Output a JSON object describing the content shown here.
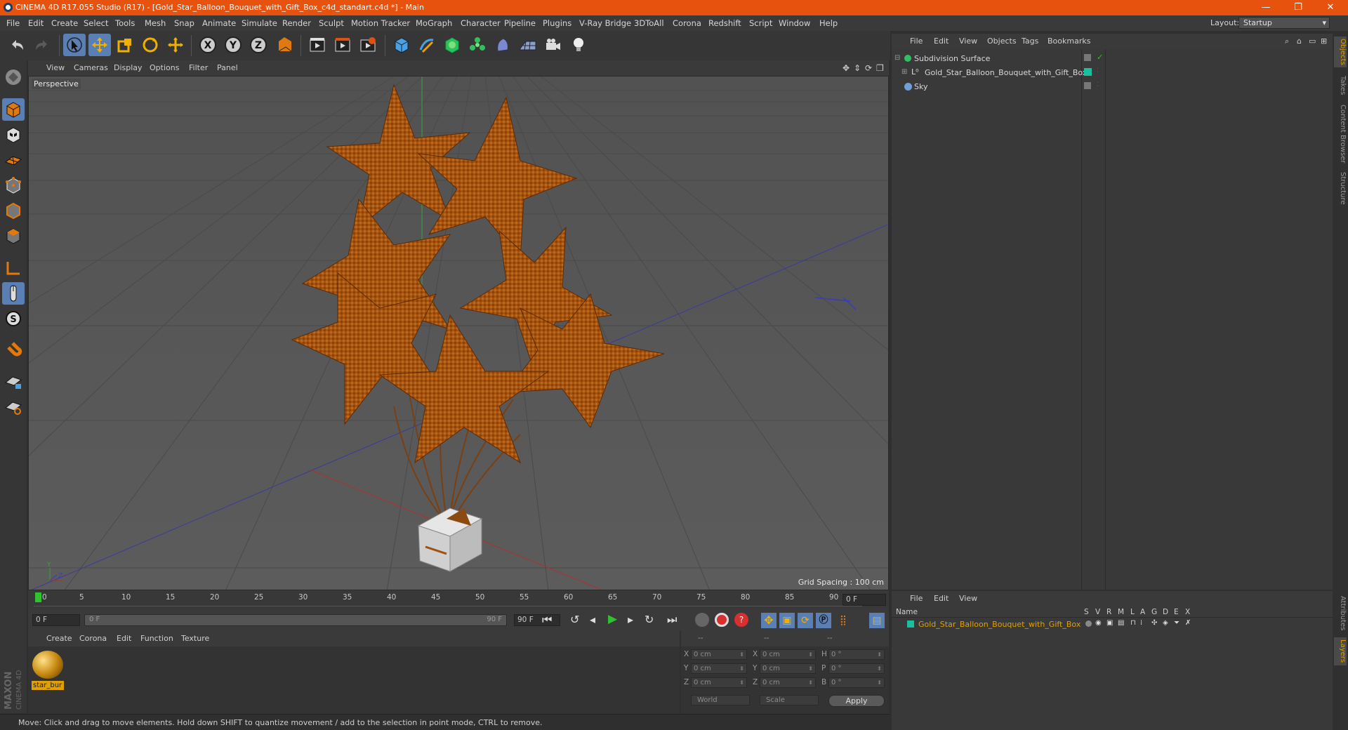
{
  "window": {
    "title": "CINEMA 4D R17.055 Studio (R17) - [Gold_Star_Balloon_Bouquet_with_Gift_Box_c4d_standart.c4d *] - Main",
    "controls": [
      "—",
      "❐",
      "✕"
    ]
  },
  "menu": {
    "items": [
      "File",
      "Edit",
      "Create",
      "Select",
      "Tools",
      "Mesh",
      "Snap",
      "Animate",
      "Simulate",
      "Render",
      "Sculpt",
      "Motion Tracker",
      "MoGraph",
      "Character",
      "Pipeline",
      "Plugins",
      "V-Ray Bridge",
      "3DToAll",
      "Corona",
      "Redshift",
      "Script",
      "Window",
      "Help"
    ],
    "layout_label": "Layout:",
    "layout_value": "Startup"
  },
  "toolbar": {
    "icons": [
      "undo-icon",
      "redo-icon",
      "select-arrow-icon",
      "move-icon",
      "scale-icon",
      "rotate-icon",
      "live-select-icon",
      "x-axis-icon",
      "y-axis-icon",
      "z-axis-icon",
      "coordinate-system-icon",
      "render-view-icon",
      "render-picture-viewer-icon",
      "render-settings-icon",
      "cube-icon",
      "pen-icon",
      "subdivision-icon",
      "array-icon",
      "deformer-icon",
      "floor-icon",
      "camera-icon",
      "light-icon"
    ]
  },
  "viewport": {
    "menu": [
      "View",
      "Cameras",
      "Display",
      "Options",
      "Filter",
      "Panel"
    ],
    "label": "Perspective",
    "grid_spacing": "Grid Spacing : 100 cm"
  },
  "timeline": {
    "ticks": [
      "0",
      "5",
      "10",
      "15",
      "20",
      "25",
      "30",
      "35",
      "40",
      "45",
      "50",
      "55",
      "60",
      "65",
      "70",
      "75",
      "80",
      "85",
      "90"
    ],
    "current_frame": "0 F",
    "start_field": "0 F",
    "slider_left": "0 F",
    "slider_right": "90 F",
    "end_field": "90 F"
  },
  "materials": {
    "menu": [
      "Create",
      "Corona",
      "Edit",
      "Function",
      "Texture"
    ],
    "items": [
      {
        "name": "star_bur"
      }
    ]
  },
  "coordinates": {
    "headers": [
      "--",
      "--",
      "--"
    ],
    "rows": [
      {
        "l1": "X",
        "v1": "0 cm",
        "l2": "X",
        "v2": "0 cm",
        "l3": "H",
        "v3": "0 °"
      },
      {
        "l1": "Y",
        "v1": "0 cm",
        "l2": "Y",
        "v2": "0 cm",
        "l3": "P",
        "v3": "0 °"
      },
      {
        "l1": "Z",
        "v1": "0 cm",
        "l2": "Z",
        "v2": "0 cm",
        "l3": "B",
        "v3": "0 °"
      }
    ],
    "mode": "World",
    "transform": "Scale",
    "apply": "Apply"
  },
  "status": {
    "text": "Move: Click and drag to move elements. Hold down SHIFT to quantize movement / add to the selection in point mode, CTRL to remove."
  },
  "objects": {
    "menu": [
      "File",
      "Edit",
      "View",
      "Objects",
      "Tags",
      "Bookmarks"
    ],
    "items": [
      {
        "name": "Subdivision Surface"
      },
      {
        "name": "Gold_Star_Balloon_Bouquet_with_Gift_Box"
      },
      {
        "name": "Sky"
      }
    ]
  },
  "layers": {
    "menu": [
      "File",
      "Edit",
      "View"
    ],
    "columns": [
      "Name",
      "S",
      "V",
      "R",
      "M",
      "L",
      "A",
      "G",
      "D",
      "E",
      "X"
    ],
    "items": [
      {
        "name": "Gold_Star_Balloon_Bouquet_with_Gift_Box",
        "color": "#18c0a0"
      }
    ]
  },
  "right_tabs": [
    "Objects",
    "Takes",
    "Content Browser",
    "Structure",
    "Attributes",
    "Layers"
  ],
  "colors": {
    "title_bar": "#e8520f",
    "selected_tool": "#5a7fb5",
    "accent_orange": "#e0a000",
    "balloon": "#b05a12"
  }
}
